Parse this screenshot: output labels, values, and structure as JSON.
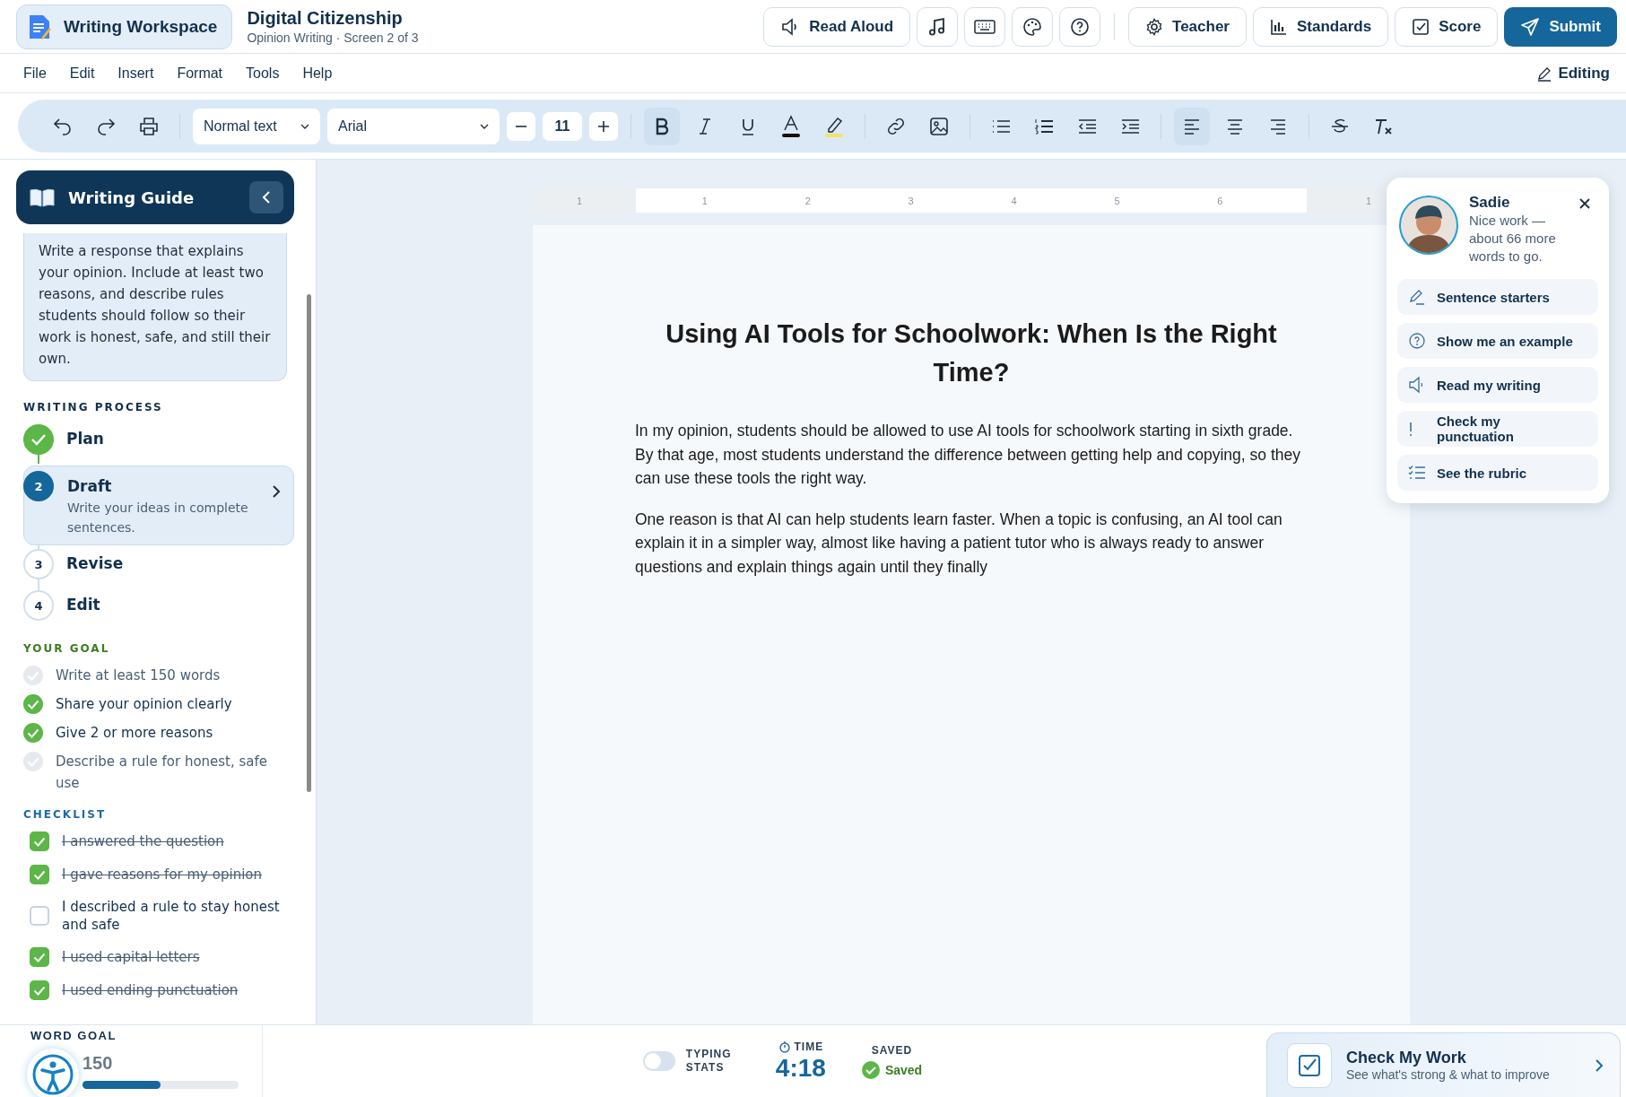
{
  "header": {
    "app_title": "Writing Workspace",
    "doc_title": "Digital Citizenship",
    "doc_subtitle": "Opinion Writing · Screen 2 of 3",
    "read_aloud": "Read Aloud",
    "actions": [
      {
        "kind": "teacher",
        "label": "Teacher"
      },
      {
        "kind": "standards",
        "label": "Standards"
      },
      {
        "kind": "score",
        "label": "Score"
      }
    ],
    "submit": "Submit"
  },
  "menu": {
    "items": [
      "File",
      "Edit",
      "Insert",
      "Format",
      "Tools",
      "Help"
    ],
    "mode": "Editing"
  },
  "toolbar": {
    "style": "Normal text",
    "font": "Arial",
    "size": "11",
    "format": [
      {
        "kind": "bold",
        "selected": true
      },
      {
        "kind": "italic",
        "selected": false
      },
      {
        "kind": "underline",
        "selected": false
      }
    ],
    "alignment": [
      {
        "kind": "left",
        "selected": true
      },
      {
        "kind": "center",
        "selected": false
      },
      {
        "kind": "right",
        "selected": false
      }
    ]
  },
  "sidebar": {
    "title": "Writing Guide",
    "prompt": "Write a response that explains your opinion. Include at least two reasons, and describe rules students should follow so their work is honest, safe, and still their own.",
    "process_heading": "WRITING PROCESS",
    "steps": [
      {
        "label": "Plan",
        "completed": true,
        "selected": false
      },
      {
        "number": "2",
        "label": "Draft",
        "description": "Write your ideas in complete sentences.",
        "completed": false,
        "selected": true
      },
      {
        "number": "3",
        "label": "Revise",
        "completed": false,
        "selected": false
      },
      {
        "number": "4",
        "label": "Edit",
        "completed": false,
        "selected": false
      }
    ],
    "goal_heading": "YOUR GOAL",
    "goals": [
      {
        "text": "Write at least 150 words",
        "done": false
      },
      {
        "text": "Share your opinion clearly",
        "done": true
      },
      {
        "text": "Give 2 or more reasons",
        "done": true
      },
      {
        "text": "Describe a rule for honest, safe use",
        "done": false
      }
    ],
    "checklist_heading": "CHECKLIST",
    "checklist": [
      {
        "text": "I answered the question",
        "checked": true
      },
      {
        "text": "I gave reasons for my opinion",
        "checked": true
      },
      {
        "text": "I described a rule to stay honest and safe",
        "checked": false
      },
      {
        "text": "I used capital letters",
        "checked": true
      },
      {
        "text": "I used ending punctuation",
        "checked": true
      }
    ]
  },
  "ruler": {
    "labels": [
      "1",
      "1",
      "2",
      "3",
      "4",
      "5",
      "6",
      "1"
    ]
  },
  "document": {
    "title": "Using AI Tools for Schoolwork: When Is the Right Time?",
    "paragraphs": [
      "In my opinion, students should be allowed to use AI tools for schoolwork starting in sixth grade. By that age, most students understand the difference between getting help and copying, so they can use these tools the right way.",
      "One reason is that AI can help students learn faster. When a topic is confusing, an AI tool can explain it in a simpler way, almost like having a patient tutor who is always ready to answer questions and explain things again until they finally"
    ]
  },
  "helper": {
    "name": "Sadie",
    "message": "Nice work — about 66 more words to go.",
    "options": [
      {
        "kind": "pencil",
        "label": "Sentence starters"
      },
      {
        "kind": "question",
        "label": "Show me an example"
      },
      {
        "kind": "speaker",
        "label": "Read my writing"
      },
      {
        "kind": "exclamation",
        "label": "Check my punctuation"
      },
      {
        "kind": "list",
        "label": "See the rubric"
      }
    ]
  },
  "footer": {
    "word_goal_label": "WORD GOAL",
    "word_goal": "150",
    "level": 0.5,
    "typing_stats": {
      "label": "TYPING STATS",
      "on": false
    },
    "time_label": "TIME",
    "time": "4:18",
    "saved_label": "SAVED",
    "saved": "Saved",
    "check_title": "Check My Work",
    "check_subtitle": "See what's strong & what to improve"
  }
}
